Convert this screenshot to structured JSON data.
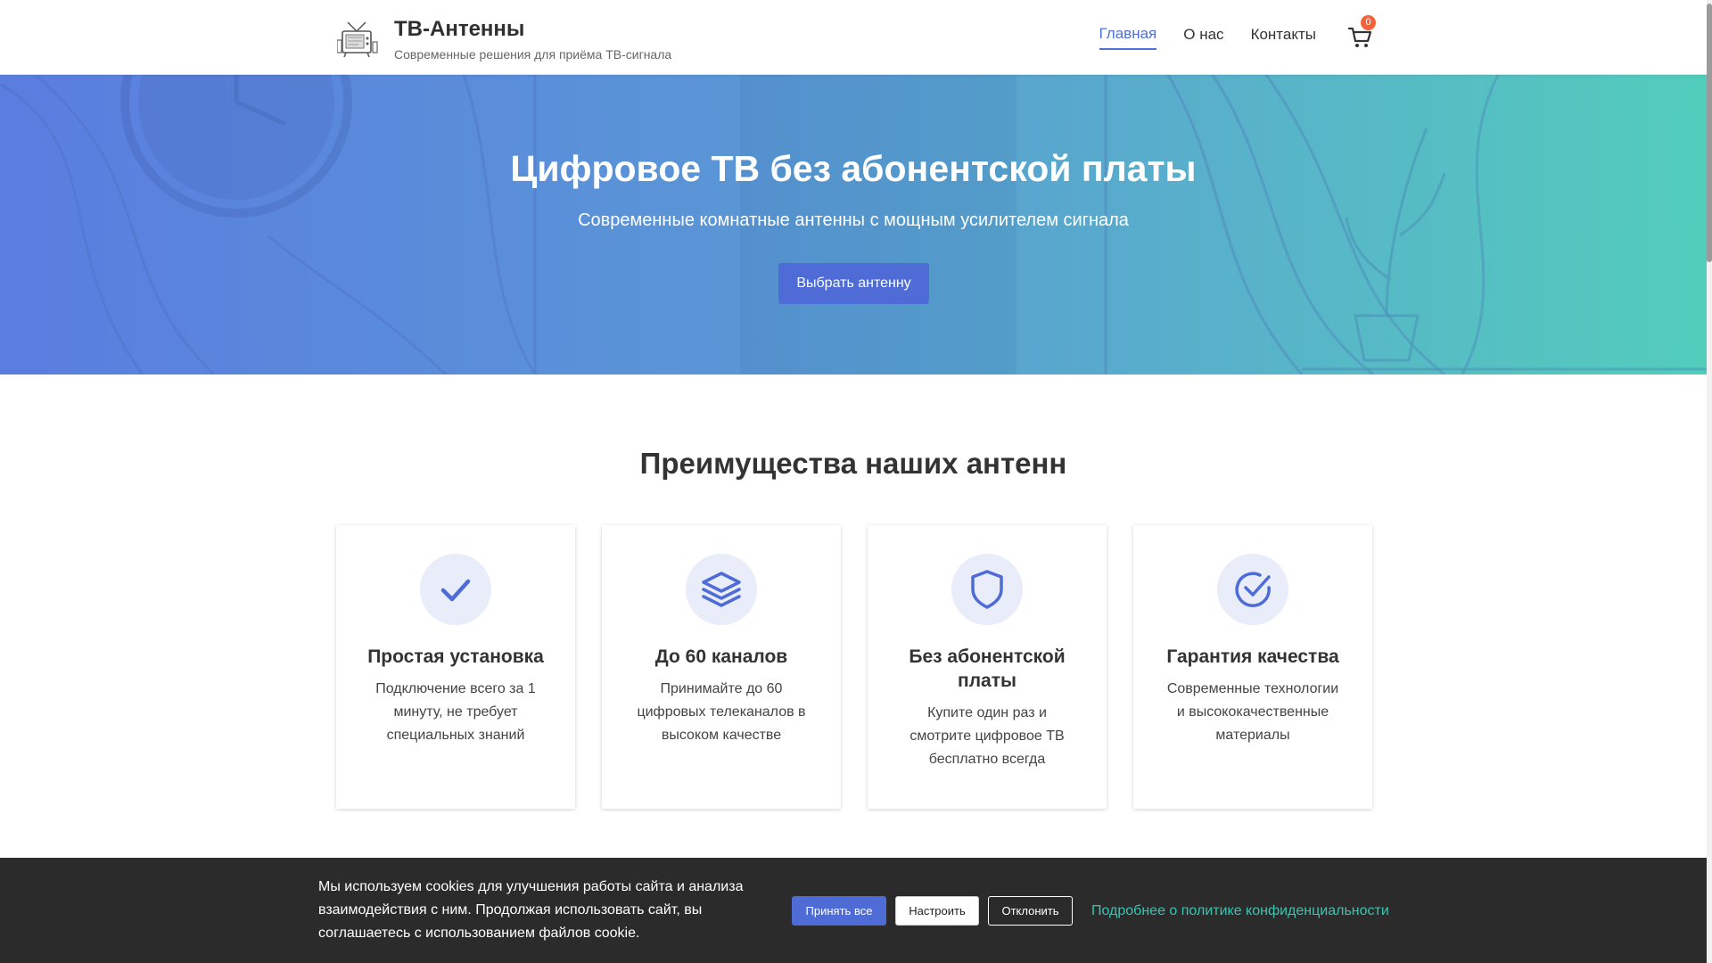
{
  "header": {
    "title": "ТВ-Антенны",
    "tagline": "Современные решения для приёма ТВ-сигнала",
    "nav": [
      {
        "label": "Главная",
        "active": true
      },
      {
        "label": "О нас",
        "active": false
      },
      {
        "label": "Контакты",
        "active": false
      }
    ],
    "cart_count": "0"
  },
  "hero": {
    "title": "Цифровое ТВ без абонентской платы",
    "subtitle": "Современные комнатные антенны с мощным усилителем сигнала",
    "button_label": "Выбрать антенну"
  },
  "features": {
    "title": "Преимущества наших антенн",
    "items": [
      {
        "icon": "check-icon",
        "title": "Простая установка",
        "text": "Подключение всего за 1 минуту, не требует специальных знаний"
      },
      {
        "icon": "layers-icon",
        "title": "До 60 каналов",
        "text": "Принимайте до 60 цифровых телеканалов в высоком качестве"
      },
      {
        "icon": "shield-icon",
        "title": "Без абонентской платы",
        "text": "Купите один раз и смотрите цифровое ТВ бесплатно всегда"
      },
      {
        "icon": "check-circle-icon",
        "title": "Гарантия качества",
        "text": "Современные технологии и высококачественные материалы"
      }
    ]
  },
  "cookie": {
    "text": "Мы используем cookies для улучшения работы сайта и анализа взаимодействия с ним. Продолжая использовать сайт, вы соглашаетесь с использованием файлов cookie.",
    "accept_label": "Принять все",
    "settings_label": "Настроить",
    "decline_label": "Отклонить",
    "policy_link": "Подробнее о политике конфиденциальности"
  },
  "colors": {
    "accent": "#4e6bd6",
    "link": "#38c5b3",
    "badge": "#f0633b",
    "cookie_bg": "#2b2b2b"
  }
}
